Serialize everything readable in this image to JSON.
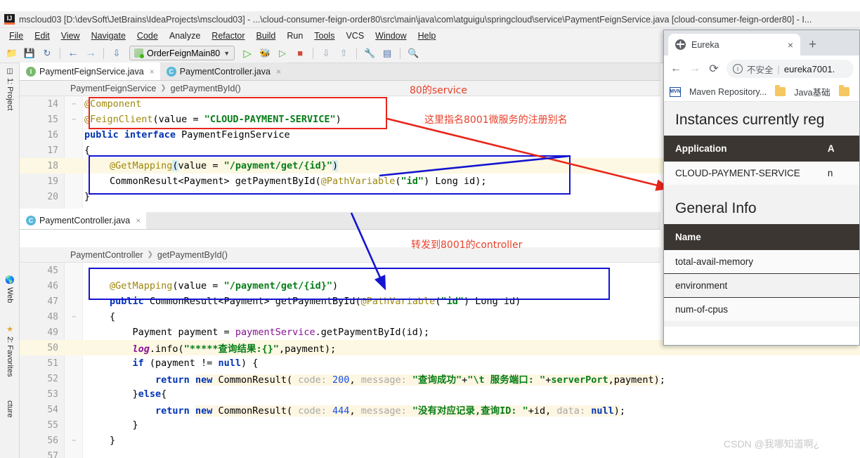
{
  "ide": {
    "window_title": "mscloud03 [D:\\devSoft\\JetBrains\\IdeaProjects\\mscloud03] - ...\\cloud-consumer-feign-order80\\src\\main\\java\\com\\atguigu\\springcloud\\service\\PaymentFeignService.java [cloud-consumer-feign-order80] - I...",
    "logo_text": "IJ",
    "menu": [
      {
        "label": "File"
      },
      {
        "label": "Edit"
      },
      {
        "label": "View"
      },
      {
        "label": "Navigate"
      },
      {
        "label": "Code"
      },
      {
        "label": "Analyze"
      },
      {
        "label": "Refactor"
      },
      {
        "label": "Build"
      },
      {
        "label": "Run"
      },
      {
        "label": "Tools"
      },
      {
        "label": "VCS"
      },
      {
        "label": "Window"
      },
      {
        "label": "Help"
      }
    ],
    "toolbar": {
      "open_icon": "open-folder-icon",
      "save_icon": "save-icon",
      "sync_icon": "sync-icon",
      "back_icon": "back-arrow-icon",
      "forward_icon": "forward-arrow-icon",
      "sort_icon": "sort-icon",
      "run_config_name": "OrderFeignMain80",
      "run_icon": "run-icon",
      "debug_icon": "debug-icon",
      "coverage_icon": "run-coverage-icon",
      "stop_icon": "stop-icon",
      "update_icon": "update-project-icon",
      "commit_icon": "commit-icon",
      "settings_icon": "settings-icon",
      "structure_icon": "project-structure-icon",
      "search_icon": "search-everywhere-icon"
    },
    "left_strip": [
      {
        "label": "1: Project",
        "icon": "project-tool-icon"
      },
      {
        "label": "Web",
        "icon": "web-tool-icon"
      },
      {
        "label": "2: Favorites",
        "icon": "favorites-star-icon"
      },
      {
        "label": "cture",
        "icon": "structure-tool-icon"
      }
    ],
    "editor1": {
      "tabs": [
        {
          "label": "PaymentFeignService.java",
          "icon_letter": "I",
          "active": true
        },
        {
          "label": "PaymentController.java",
          "icon_letter": "C",
          "active": false
        }
      ],
      "breadcrumb": [
        "PaymentFeignService",
        "getPaymentById()"
      ],
      "lines": [
        {
          "n": "14",
          "hl": false,
          "fold": "−"
        },
        {
          "n": "15",
          "hl": false,
          "fold": "−"
        },
        {
          "n": "16",
          "hl": false,
          "fold": ""
        },
        {
          "n": "17",
          "hl": false,
          "fold": ""
        },
        {
          "n": "18",
          "hl": true,
          "fold": ""
        },
        {
          "n": "19",
          "hl": false,
          "fold": ""
        },
        {
          "n": "20",
          "hl": false,
          "fold": ""
        }
      ]
    },
    "editor2": {
      "tabs": [
        {
          "label": "PaymentController.java",
          "icon_letter": "C",
          "active": true
        }
      ],
      "breadcrumb": [
        "PaymentController",
        "getPaymentById()"
      ],
      "lines": [
        {
          "n": "45",
          "hl": false,
          "fold": ""
        },
        {
          "n": "46",
          "hl": false,
          "fold": ""
        },
        {
          "n": "47",
          "hl": false,
          "fold": ""
        },
        {
          "n": "48",
          "hl": false,
          "fold": "−"
        },
        {
          "n": "49",
          "hl": false,
          "fold": ""
        },
        {
          "n": "50",
          "hl": true,
          "fold": ""
        },
        {
          "n": "51",
          "hl": false,
          "fold": ""
        },
        {
          "n": "52",
          "hl": false,
          "fold": ""
        },
        {
          "n": "53",
          "hl": false,
          "fold": ""
        },
        {
          "n": "54",
          "hl": false,
          "fold": ""
        },
        {
          "n": "55",
          "hl": false,
          "fold": ""
        },
        {
          "n": "56",
          "hl": false,
          "fold": "−"
        },
        {
          "n": "57",
          "hl": false,
          "fold": ""
        }
      ]
    }
  },
  "annotations": [
    {
      "id": "a1",
      "text": "80的service",
      "color": "#e8402a"
    },
    {
      "id": "a2",
      "text": "这里指名8001微服务的注册别名",
      "color": "#e8402a"
    },
    {
      "id": "a3",
      "text": "转发到8001的controller",
      "color": "#e8402a"
    }
  ],
  "browser": {
    "tab_title": "Eureka",
    "tab_close": "×",
    "new_tab": "+",
    "back": "←",
    "forward": "→",
    "reload": "⟳",
    "security_label": "不安全",
    "url": "eureka7001.",
    "bookmarks": [
      {
        "label": "Maven Repository...",
        "icon": "mvn-bookmark-icon"
      },
      {
        "label": "Java基础",
        "icon": "folder-icon"
      },
      {
        "label": "",
        "icon": "folder-icon"
      }
    ],
    "page": {
      "instances_heading": "Instances currently reg",
      "instances_table": {
        "headers": [
          "Application",
          "A"
        ],
        "rows": [
          [
            "CLOUD-PAYMENT-SERVICE",
            "n"
          ]
        ]
      },
      "general_heading": "General Info",
      "general_table": {
        "headers": [
          "Name"
        ],
        "rows": [
          [
            "total-avail-memory"
          ],
          [
            "environment"
          ],
          [
            "num-of-cpus"
          ]
        ]
      }
    }
  },
  "watermark": "CSDN @我哪知道啊¿"
}
